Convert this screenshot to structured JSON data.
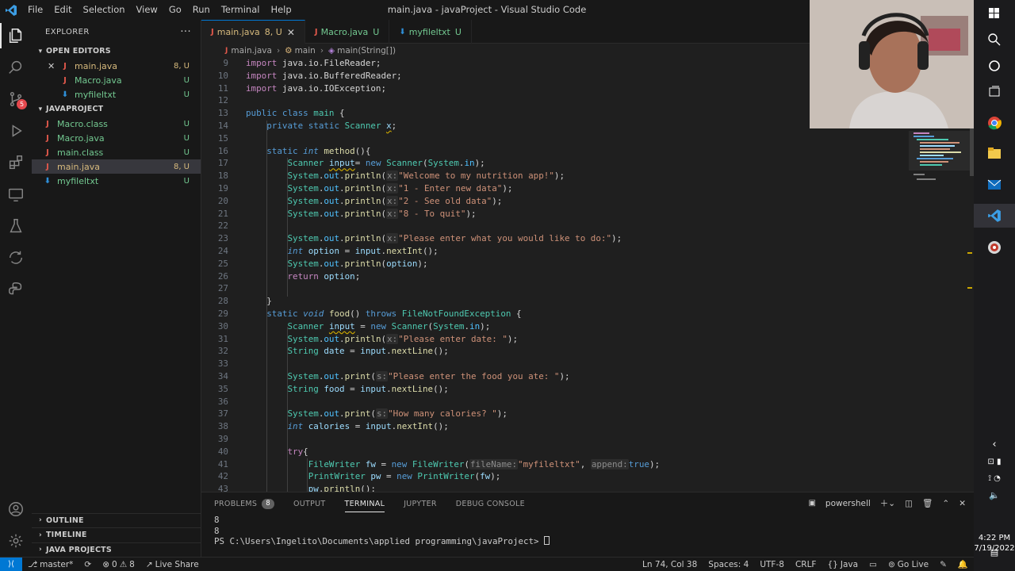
{
  "titlebar": {
    "menu": [
      "File",
      "Edit",
      "Selection",
      "View",
      "Go",
      "Run",
      "Terminal",
      "Help"
    ],
    "window_title": "main.java - javaProject - Visual Studio Code"
  },
  "activity": {
    "scm_badge": "5"
  },
  "explorer": {
    "title": "EXPLORER",
    "more_label": "···",
    "open_editors_title": "OPEN EDITORS",
    "open_editors": [
      {
        "name": "main.java",
        "status": "8, U",
        "icon": "J"
      },
      {
        "name": "Macro.java",
        "status": "U",
        "icon": "J"
      },
      {
        "name": "myfileltxt",
        "status": "U",
        "icon": "⬇"
      }
    ],
    "project_title": "JAVAPROJECT",
    "project_files": [
      {
        "name": "Macro.class",
        "status": "U",
        "icon": "J"
      },
      {
        "name": "Macro.java",
        "status": "U",
        "icon": "J"
      },
      {
        "name": "main.class",
        "status": "U",
        "icon": "J"
      },
      {
        "name": "main.java",
        "status": "8, U",
        "icon": "J"
      },
      {
        "name": "myfileltxt",
        "status": "U",
        "icon": "⬇"
      }
    ],
    "outline": "OUTLINE",
    "timeline": "TIMELINE",
    "java_projects": "JAVA PROJECTS"
  },
  "tabs": [
    {
      "name": "main.java",
      "status": "8, U"
    },
    {
      "name": "Macro.java",
      "status": "U"
    },
    {
      "name": "myfileltxt",
      "status": "U"
    }
  ],
  "breadcrumb": [
    "main.java",
    "main",
    "main(String[])"
  ],
  "code": {
    "line_numbers": [
      "9",
      "10",
      "11",
      "12",
      "13",
      "14",
      "15",
      "16",
      "17",
      "18",
      "19",
      "20",
      "21",
      "22",
      "23",
      "24",
      "25",
      "26",
      "27",
      "28",
      "29",
      "30",
      "31",
      "32",
      "33",
      "34",
      "35",
      "36",
      "37",
      "38",
      "39",
      "40",
      "41",
      "42",
      "43"
    ],
    "t": {
      "import": "import",
      "public": "public",
      "class": "class",
      "private": "private",
      "static": "static",
      "int": "int",
      "new": "new",
      "return": "return",
      "void": "void",
      "throws": "throws",
      "try": "try",
      "t_filereader": "java.io.FileReader;",
      "t_bufferedreader": "java.io.BufferedReader;",
      "t_ioexception": "java.io.IOException;",
      "main": "main",
      "scanner": "Scanner",
      "x": "x",
      "method": "method",
      "input": "input",
      "system": "System",
      "in": "in",
      "out": "out",
      "println": "println",
      "print": "print",
      "hx": "x:",
      "hs": "s:",
      "s_welcome": "\"Welcome to my nutrition app!\"",
      "s_1": "\"1 - Enter new data\"",
      "s_2": "\"2 - See old data\"",
      "s_8": "\"8 - To quit\"",
      "s_please": "\"Please enter what you would like to do:\"",
      "option": "option",
      "nextInt": "nextInt",
      "nextLine": "nextLine",
      "food": "food",
      "fnfe": "FileNotFoundException",
      "s_date": "\"Please enter date: \"",
      "string": "String",
      "date": "date",
      "s_food": "\"Please enter the food you ate: \"",
      "s_cal": "\"How many calories? \"",
      "calories": "calories",
      "filewriter": "FileWriter",
      "fw": "fw",
      "hfile": "fileName:",
      "s_myfile": "\"myfileltxt\"",
      "happend": "append:",
      "true": "true",
      "printwriter": "PrintWriter",
      "pw": "pw"
    }
  },
  "panel": {
    "tabs": [
      "PROBLEMS",
      "OUTPUT",
      "TERMINAL",
      "JUPYTER",
      "DEBUG CONSOLE"
    ],
    "problems_count": "8",
    "shell": "powershell",
    "terminal_lines": [
      "8",
      "8"
    ],
    "prompt": "PS C:\\Users\\Ingelito\\Documents\\applied programming\\javaProject> "
  },
  "statusbar": {
    "branch": "master*",
    "errors": "0",
    "warnings": "8",
    "live_share": "Live Share",
    "position": "Ln 74, Col 38",
    "spaces": "Spaces: 4",
    "encoding": "UTF-8",
    "eol": "CRLF",
    "language": "Java",
    "go_live": "Go Live"
  },
  "taskbar": {
    "time": "4:22 PM",
    "date": "7/19/2022"
  },
  "colors": {
    "accent": "#0078d4",
    "keyword": "#569cd6",
    "type": "#4ec9b0",
    "string": "#ce9178",
    "func": "#dcdcaa"
  }
}
